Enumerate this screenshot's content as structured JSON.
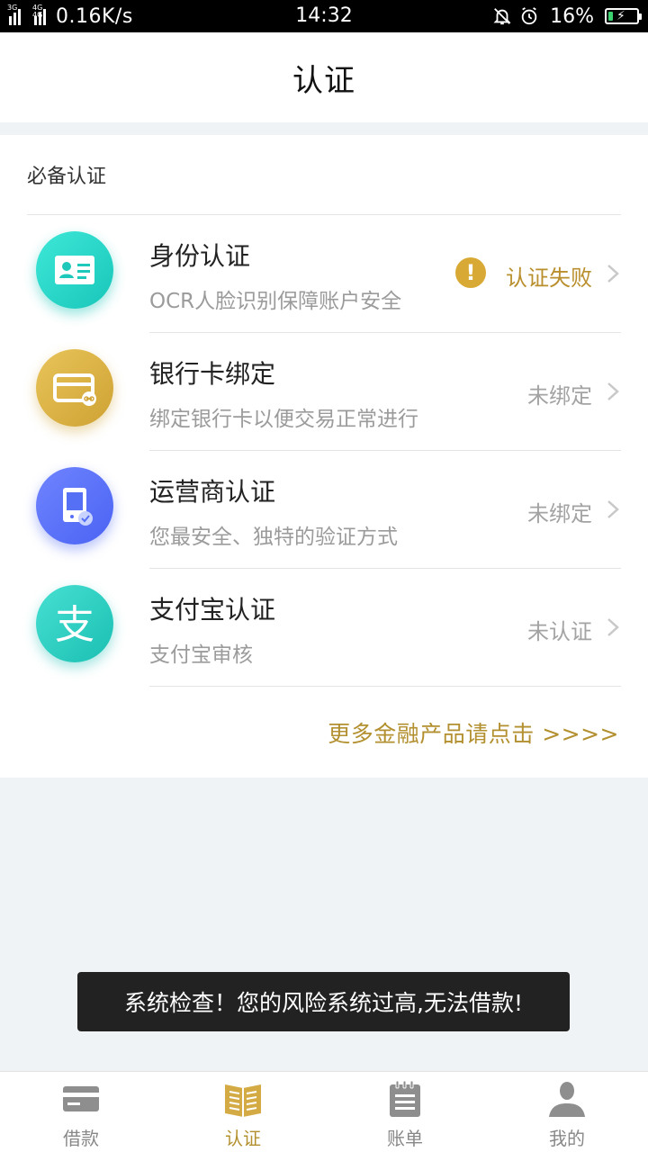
{
  "status_bar": {
    "network_1": "3G",
    "network_2": "4G 4G",
    "speed": "0.16K/s",
    "time": "14:32",
    "battery": "16%",
    "battery_level": 0.16
  },
  "header": {
    "title": "认证"
  },
  "section": {
    "title": "必备认证"
  },
  "items": [
    {
      "title": "身份认证",
      "desc": "OCR人脸识别保障账户安全",
      "status": "认证失败",
      "icon": "id-card-icon"
    },
    {
      "title": "银行卡绑定",
      "desc": "绑定银行卡以便交易正常进行",
      "status": "未绑定",
      "icon": "bank-card-icon"
    },
    {
      "title": "运营商认证",
      "desc": "您最安全、独特的验证方式",
      "status": "未绑定",
      "icon": "phone-icon"
    },
    {
      "title": "支付宝认证",
      "desc": "支付宝审核",
      "status": "未认证",
      "icon": "alipay-icon"
    }
  ],
  "more_link": "更多金融产品请点击 >>>>",
  "toast": "系统检查！您的风险系统过高,无法借款!",
  "tabs": [
    {
      "label": "借款",
      "icon": "card-icon"
    },
    {
      "label": "认证",
      "icon": "book-icon",
      "active": true
    },
    {
      "label": "账单",
      "icon": "notepad-icon"
    },
    {
      "label": "我的",
      "icon": "person-icon"
    }
  ],
  "colors": {
    "accent": "#b3902f",
    "teal": "#18c6b9",
    "blue": "#4a63f3",
    "gold": "#cfa233"
  }
}
